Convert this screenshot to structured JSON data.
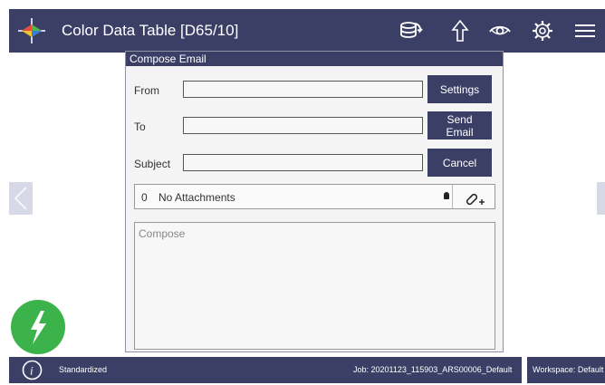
{
  "header": {
    "title": "Color Data Table [D65/10]",
    "icons": [
      "logo-icon",
      "database-sync-icon",
      "share-up-icon",
      "eye-icon",
      "gear-icon",
      "menu-icon"
    ]
  },
  "dialog": {
    "title": "Compose Email",
    "from_label": "From",
    "from_value": "",
    "to_label": "To",
    "to_value": "",
    "subject_label": "Subject",
    "subject_value": "",
    "settings_label": "Settings",
    "send_label": "Send Email",
    "cancel_label": "Cancel",
    "attachments_count": "0",
    "attachments_label": "No Attachments",
    "compose_placeholder": "Compose"
  },
  "status": {
    "standardized": "Standardized",
    "job": "Job: 20201123_115903_ARS00006_Default",
    "workspace": "Workspace: Default"
  },
  "colors": {
    "bar": "#3b3f66",
    "fab": "#3cb34a"
  }
}
